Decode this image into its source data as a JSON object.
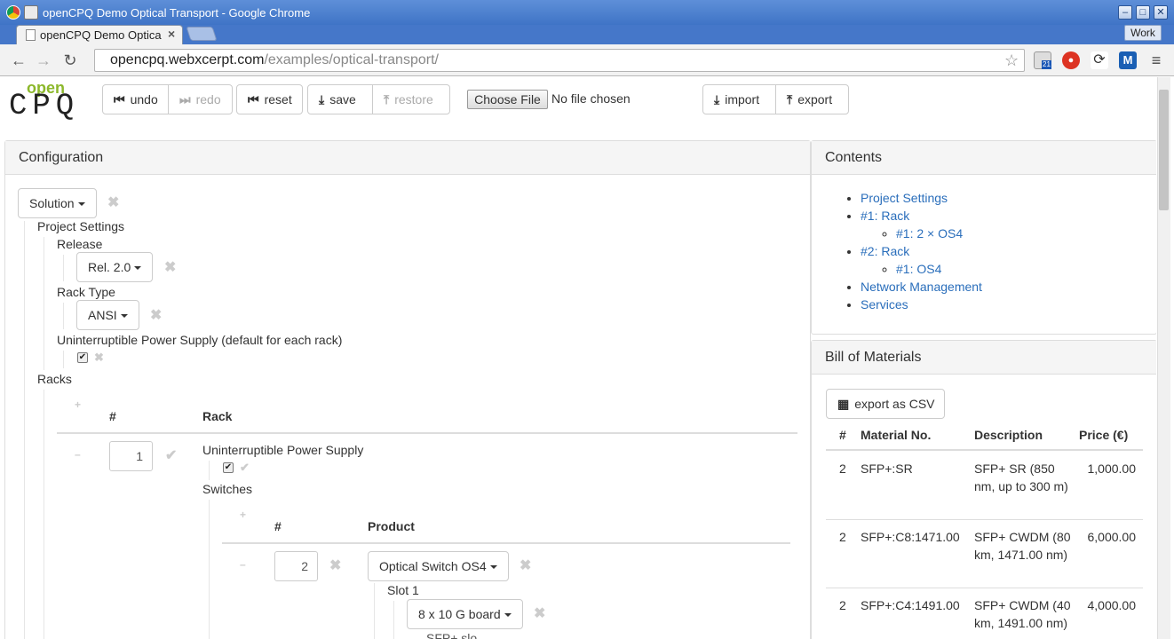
{
  "window": {
    "title": "openCPQ Demo Optical Transport - Google Chrome",
    "badge": "Work"
  },
  "tab": {
    "title": "openCPQ Demo Optica",
    "close": "×"
  },
  "address": {
    "host": "opencpq.webxcerpt.com",
    "path": "/examples/optical-transport/"
  },
  "extensions": {
    "calendar_badge": "21"
  },
  "logo": {
    "line1": "open",
    "line2": "CPQ"
  },
  "toolbar": {
    "undo": "undo",
    "redo": "redo",
    "reset": "reset",
    "save": "save",
    "restore": "restore",
    "choose_file": "Choose File",
    "no_file": "No file chosen",
    "import": "import",
    "export": "export"
  },
  "configuration": {
    "title": "Configuration",
    "solution": "Solution",
    "project_settings": "Project Settings",
    "release_label": "Release",
    "release_value": "Rel. 2.0",
    "rack_type_label": "Rack Type",
    "rack_type_value": "ANSI",
    "ups_default_label": "Uninterruptible Power Supply (default for each rack)",
    "ups_default_checked": true,
    "racks_label": "Racks",
    "racks_table": {
      "col_num": "#",
      "col_rack": "Rack",
      "row_qty": "1"
    },
    "rack_ups_label": "Uninterruptible Power Supply",
    "switches_label": "Switches",
    "switches_table": {
      "col_num": "#",
      "col_product": "Product",
      "row_qty": "2",
      "product_value": "Optical Switch OS4"
    },
    "slot1_label": "Slot 1",
    "slot1_value": "8 x 10 G board",
    "cut_text": "SFP+ slo"
  },
  "contents": {
    "title": "Contents",
    "items": [
      {
        "label": "Project Settings"
      },
      {
        "label": "#1: Rack",
        "children": [
          "#1: 2 × OS4"
        ]
      },
      {
        "label": "#2: Rack",
        "children": [
          "#1: OS4"
        ]
      },
      {
        "label": "Network Management"
      },
      {
        "label": "Services"
      }
    ]
  },
  "bom": {
    "title": "Bill of Materials",
    "export_csv": "export as CSV",
    "columns": [
      "#",
      "Material No.",
      "Description",
      "Price (€)"
    ],
    "rows": [
      {
        "qty": "2",
        "material": "SFP+:SR",
        "description": "SFP+ SR (850 nm, up to 300 m)",
        "price": "1,000.00"
      },
      {
        "qty": "2",
        "material": "SFP+:C8:1471.00",
        "description": "SFP+ CWDM (80 km, 1471.00 nm)",
        "price": "6,000.00"
      },
      {
        "qty": "2",
        "material": "SFP+:C4:1491.00",
        "description": "SFP+ CWDM (40 km, 1491.00 nm)",
        "price": "4,000.00"
      }
    ]
  }
}
